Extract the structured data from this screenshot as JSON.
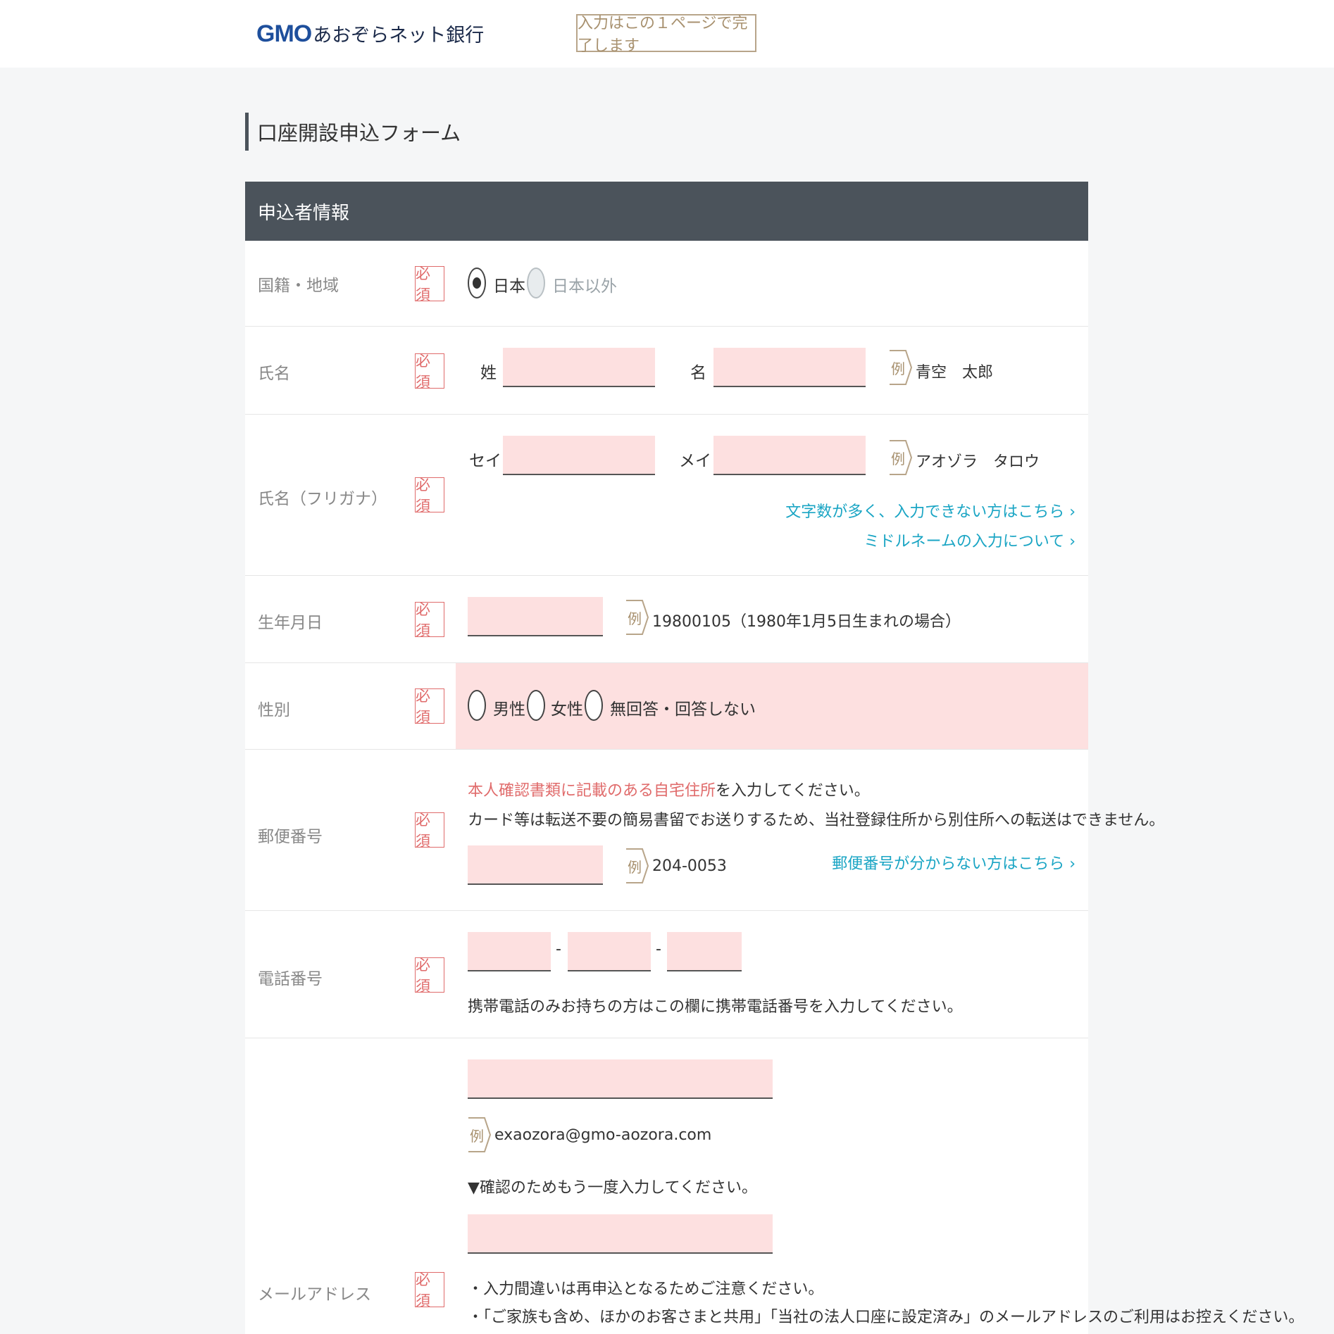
{
  "header": {
    "logo_gmo": "GMO",
    "logo_rest": "あおぞらネット銀行",
    "badge": "入力はこの１ページで完了します"
  },
  "page_title": "口座開設申込フォーム",
  "section_title": "申込者情報",
  "required_label": "必須",
  "example_label": "例",
  "rows": {
    "nationality": {
      "label": "国籍・地域",
      "options": [
        "日本",
        "日本以外"
      ],
      "selected": "日本"
    },
    "name": {
      "label": "氏名",
      "last_label": "姓",
      "first_label": "名",
      "last_value": "",
      "first_value": "",
      "example": "青空　太郎"
    },
    "kana": {
      "label": "氏名（フリガナ）",
      "last_label": "セイ",
      "first_label": "メイ",
      "last_value": "",
      "first_value": "",
      "example": "アオゾラ　タロウ",
      "link1": "文字数が多く、入力できない方はこちら ›",
      "link2": "ミドルネームの入力について ›"
    },
    "birthday": {
      "label": "生年月日",
      "value": "",
      "example": "19800105（1980年1月5日生まれの場合）"
    },
    "gender": {
      "label": "性別",
      "options": [
        "男性",
        "女性",
        "無回答・回答しない"
      ]
    },
    "postal": {
      "label": "郵便番号",
      "note_red": "本人確認書類に記載のある自宅住所",
      "note_rest": "を入力してください。",
      "note2": "カード等は転送不要の簡易書留でお送りするため、当社登録住所から別住所への転送はできません。",
      "value": "",
      "example": "204-0053",
      "link": "郵便番号が分からない方はこちら ›"
    },
    "phone": {
      "label": "電話番号",
      "separator": "-",
      "part1": "",
      "part2": "",
      "part3": "",
      "note": "携帯電話のみお持ちの方はこの欄に携帯電話番号を入力してください。"
    },
    "email": {
      "label": "メールアドレス",
      "value": "",
      "example": "exaozora@gmo-aozora.com",
      "confirm_note": "▼確認のためもう一度入力してください。",
      "confirm_value": "",
      "bullet1": "・入力間違いは再申込となるためご注意ください。",
      "bullet2": "・「ご家族も含め、ほかのお客さまと共用」「当社の法人口座に設定済み」のメールアドレスのご利用はお控えください。"
    }
  }
}
